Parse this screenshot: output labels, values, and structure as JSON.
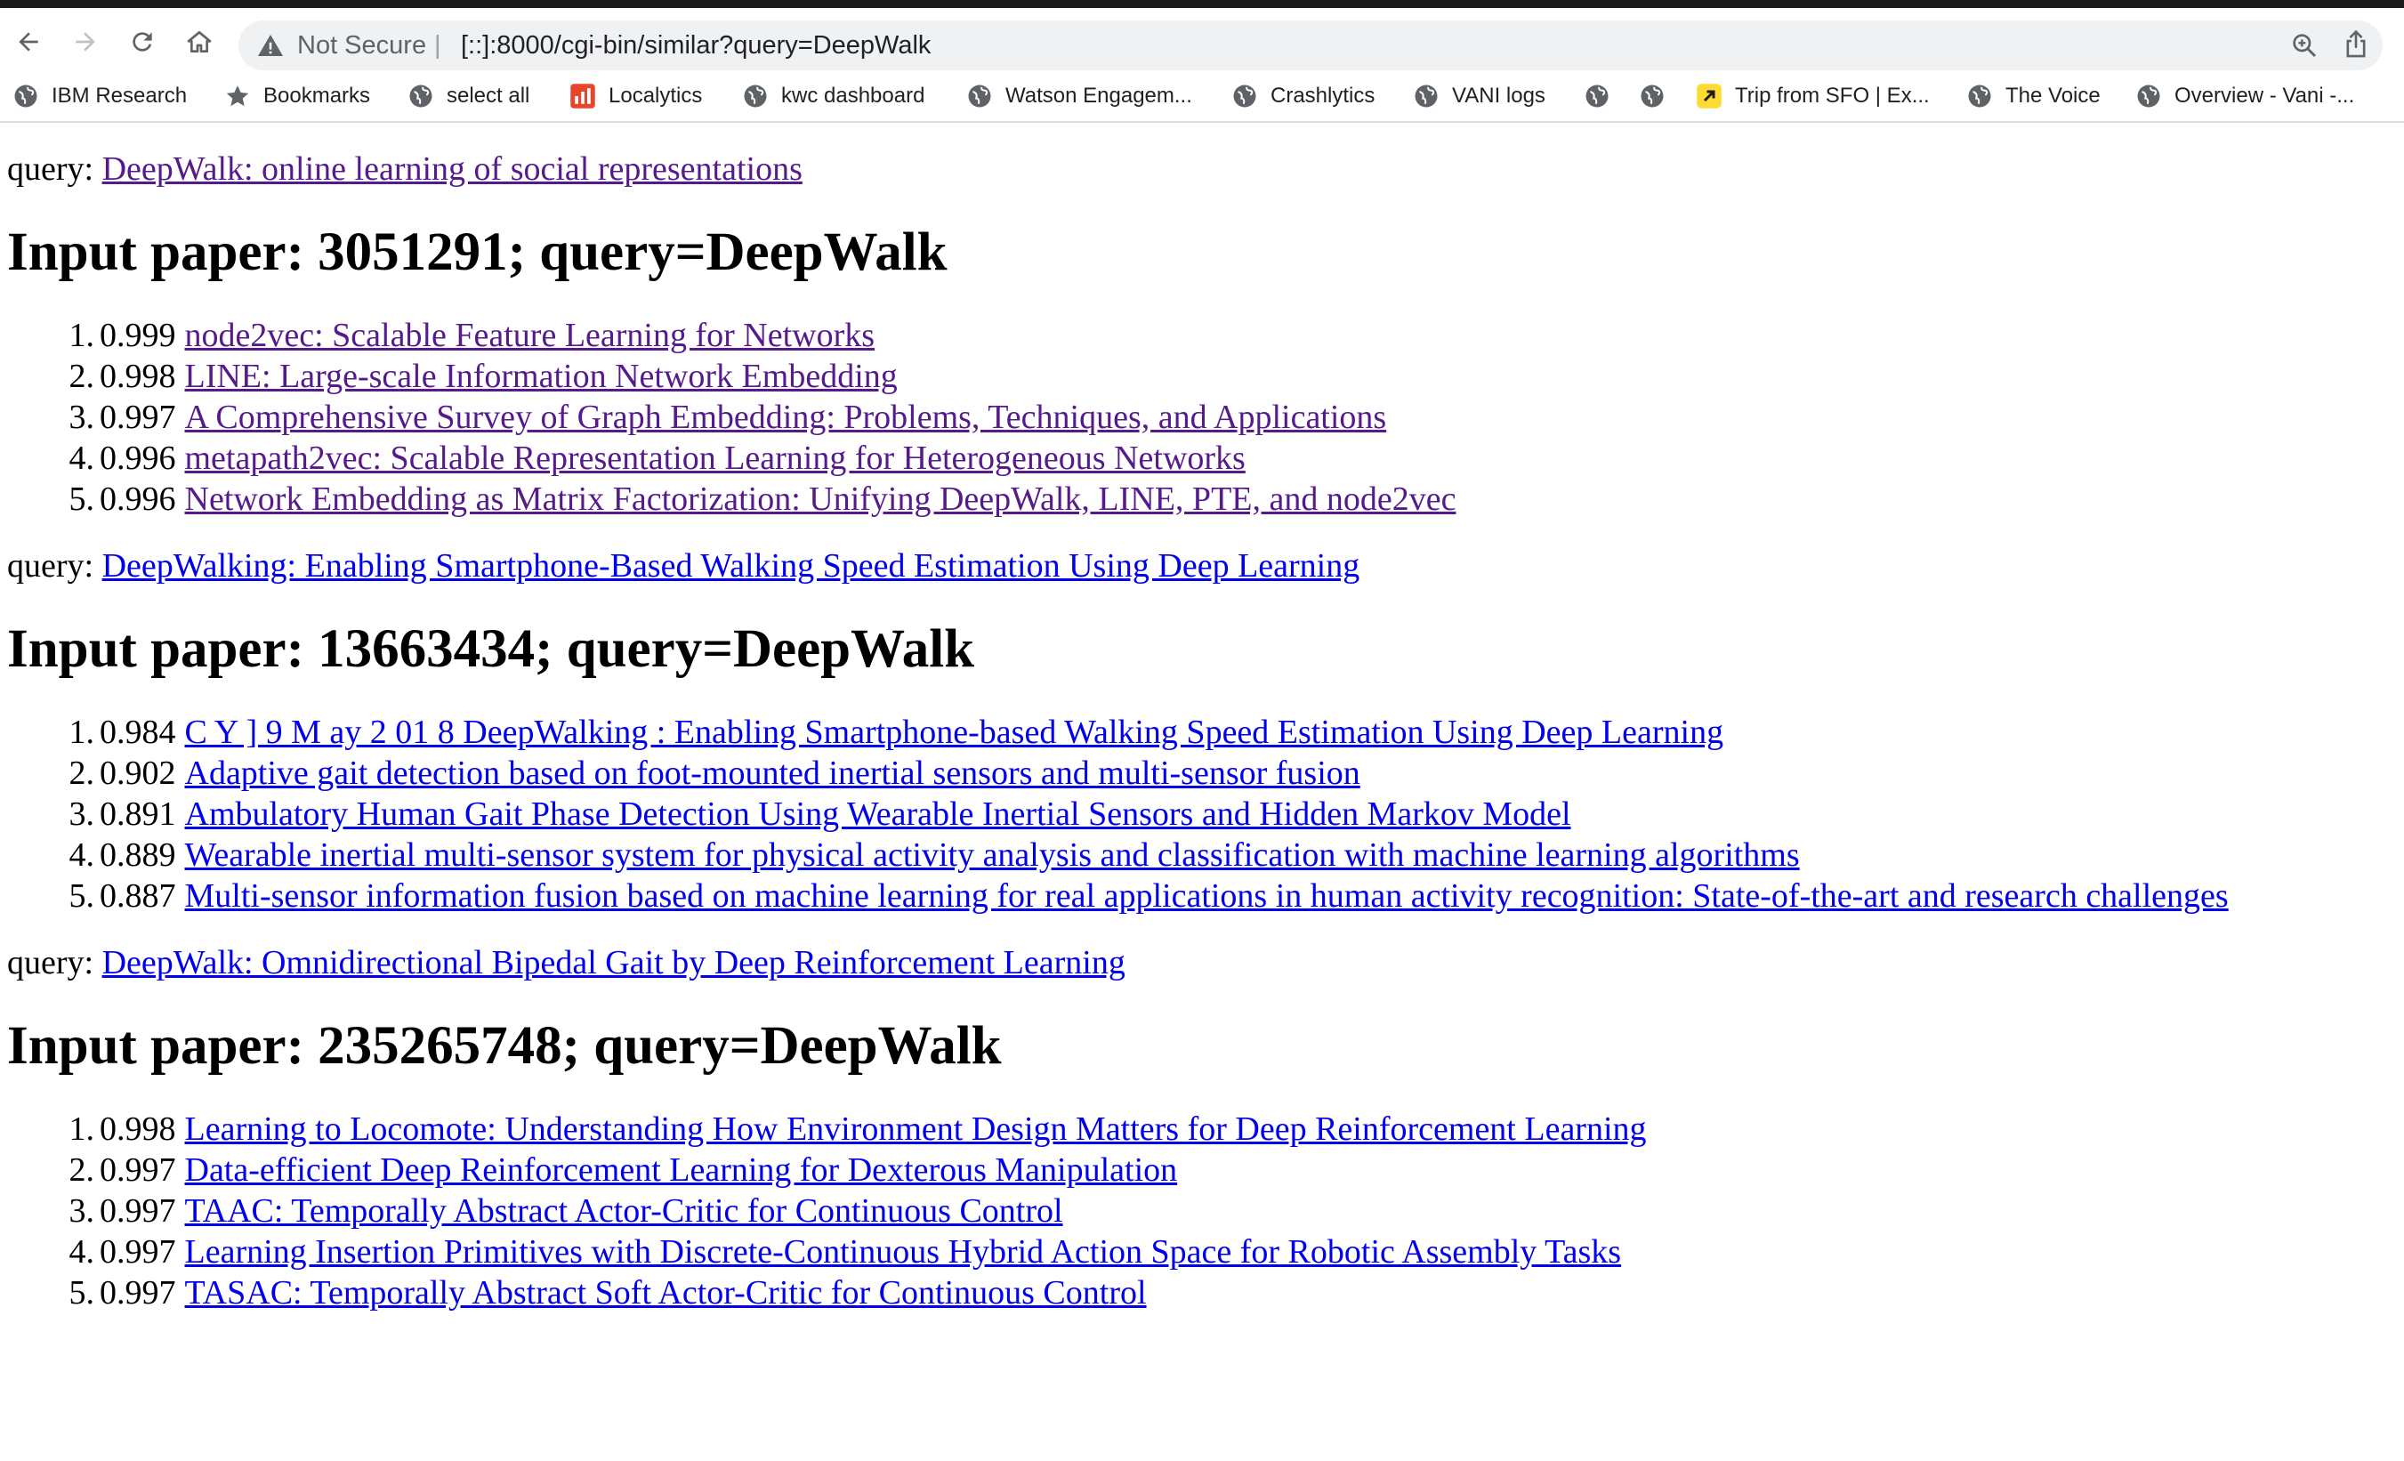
{
  "browser": {
    "security_label": "Not Secure",
    "separator": "|",
    "url": "[::]:8000/cgi-bin/similar?query=DeepWalk",
    "bookmarks": [
      {
        "label": "IBM Research",
        "icon": "globe-icon"
      },
      {
        "label": "Bookmarks",
        "icon": "star-icon"
      },
      {
        "label": "select all",
        "icon": "globe-icon"
      },
      {
        "label": "Localytics",
        "icon": "localytics-icon"
      },
      {
        "label": "kwc dashboard",
        "icon": "globe-icon"
      },
      {
        "label": "Watson Engagem...",
        "icon": "globe-icon"
      },
      {
        "label": "Crashlytics",
        "icon": "globe-icon"
      },
      {
        "label": "VANI logs",
        "icon": "globe-icon"
      },
      {
        "label": "",
        "icon": "globe-icon"
      },
      {
        "label": "",
        "icon": "globe-icon"
      },
      {
        "label": "Trip from SFO | Ex...",
        "icon": "expedia-icon"
      },
      {
        "label": "The Voice",
        "icon": "globe-icon"
      },
      {
        "label": "Overview - Vani -...",
        "icon": "globe-icon"
      }
    ]
  },
  "query_prefix": "query:",
  "blocks": [
    {
      "query_title": "DeepWalk: online learning of social representations",
      "heading": "Input paper: 3051291; query=DeepWalk",
      "results": [
        {
          "num": "1.",
          "score": "0.999",
          "title": "node2vec: Scalable Feature Learning for Networks"
        },
        {
          "num": "2.",
          "score": "0.998",
          "title": "LINE: Large-scale Information Network Embedding"
        },
        {
          "num": "3.",
          "score": "0.997",
          "title": "A Comprehensive Survey of Graph Embedding: Problems, Techniques, and Applications"
        },
        {
          "num": "4.",
          "score": "0.996",
          "title": "metapath2vec: Scalable Representation Learning for Heterogeneous Networks"
        },
        {
          "num": "5.",
          "score": "0.996",
          "title": "Network Embedding as Matrix Factorization: Unifying DeepWalk, LINE, PTE, and node2vec"
        }
      ]
    },
    {
      "query_title": "DeepWalking: Enabling Smartphone-Based Walking Speed Estimation Using Deep Learning",
      "heading": "Input paper: 13663434; query=DeepWalk",
      "results": [
        {
          "num": "1.",
          "score": "0.984",
          "title": "C Y ] 9 M ay 2 01 8 DeepWalking : Enabling Smartphone-based Walking Speed Estimation Using Deep Learning"
        },
        {
          "num": "2.",
          "score": "0.902",
          "title": "Adaptive gait detection based on foot-mounted inertial sensors and multi-sensor fusion"
        },
        {
          "num": "3.",
          "score": "0.891",
          "title": "Ambulatory Human Gait Phase Detection Using Wearable Inertial Sensors and Hidden Markov Model"
        },
        {
          "num": "4.",
          "score": "0.889",
          "title": "Wearable inertial multi-sensor system for physical activity analysis and classification with machine learning algorithms"
        },
        {
          "num": "5.",
          "score": "0.887",
          "title": "Multi-sensor information fusion based on machine learning for real applications in human activity recognition: State-of-the-art and research challenges"
        }
      ]
    },
    {
      "query_title": "DeepWalk: Omnidirectional Bipedal Gait by Deep Reinforcement Learning",
      "heading": "Input paper: 235265748; query=DeepWalk",
      "results": [
        {
          "num": "1.",
          "score": "0.998",
          "title": "Learning to Locomote: Understanding How Environment Design Matters for Deep Reinforcement Learning"
        },
        {
          "num": "2.",
          "score": "0.997",
          "title": "Data-efficient Deep Reinforcement Learning for Dexterous Manipulation"
        },
        {
          "num": "3.",
          "score": "0.997",
          "title": "TAAC: Temporally Abstract Actor-Critic for Continuous Control"
        },
        {
          "num": "4.",
          "score": "0.997",
          "title": "Learning Insertion Primitives with Discrete-Continuous Hybrid Action Space for Robotic Assembly Tasks"
        },
        {
          "num": "5.",
          "score": "0.997",
          "title": "TASAC: Temporally Abstract Soft Actor-Critic for Continuous Control"
        }
      ]
    }
  ]
}
